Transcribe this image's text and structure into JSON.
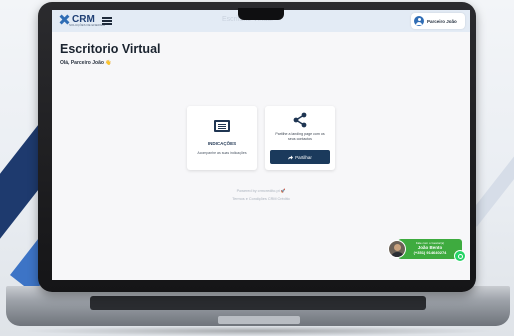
{
  "app": {
    "logo_text": "CRM",
    "logo_subtitle": "SOLUÇÕES DE ENERGIA",
    "topbar_title": "Escritorio Virtual",
    "user_name": "Parceiro João",
    "accent_color": "#1b3a5c",
    "brand_blue": "#2f6db5"
  },
  "page": {
    "title": "Escritorio Virtual",
    "greeting": "Olá, Parceiro João 👋"
  },
  "cards": {
    "indicacoes": {
      "icon": "list-icon",
      "title": "INDICAÇÕES",
      "subtitle": "Acompanhe as suas indicações"
    },
    "share": {
      "icon": "share-icon",
      "description": "Partilhe a landing page com os seus contactos",
      "button_label": "Partilhar",
      "button_icon": "share-arrow-icon"
    }
  },
  "footer": {
    "powered": "Powered by crmcredito.pt 🚀",
    "terms": "Termos e Condições CRM Crédito"
  },
  "whatsapp": {
    "line1": "Fale com o Gestor(a)",
    "name": "João Bento",
    "phone": "(+351) 914640274",
    "icon": "whatsapp-icon",
    "color": "#3eab3f"
  }
}
